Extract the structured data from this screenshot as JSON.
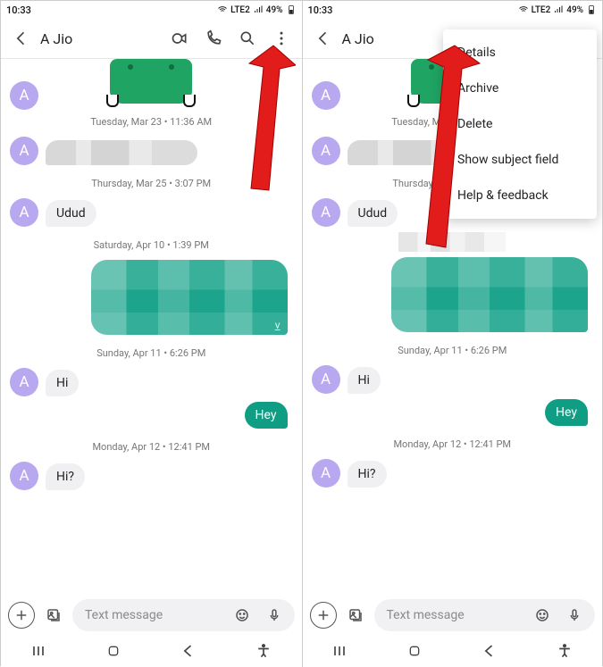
{
  "status": {
    "time": "10:33",
    "signal": "LTE2",
    "battery": "49%"
  },
  "chat": {
    "contactInitial": "A",
    "title": "A Jio",
    "days": {
      "d1": "Tuesday, Mar 23 • 11:36 AM",
      "d2": "Thursday, Mar 25 • 3:07 PM",
      "d3": "Saturday, Apr 10 • 1:39 PM",
      "d4": "Sunday, Apr 11 • 6:26 PM",
      "d5": "Monday, Apr 12 • 12:41 PM"
    },
    "msgs": {
      "m1": "Udud",
      "m2": "Hi",
      "m3": "Hey",
      "m4": "Hi?"
    }
  },
  "composer": {
    "placeholder": "Text message"
  },
  "menu": {
    "details": "Details",
    "archive": "Archive",
    "delete": "Delete",
    "subject": "Show subject field",
    "help": "Help & feedback"
  },
  "icons": {
    "back": "back-icon",
    "duo": "video-call-duo-icon",
    "call": "phone-icon",
    "search": "search-icon",
    "overflow": "overflow-menu-icon",
    "plus": "plus-icon",
    "gallery": "gallery-icon",
    "emoji": "emoji-icon",
    "mic": "mic-icon",
    "recents": "recents-nav-icon",
    "home": "home-nav-icon",
    "backnav": "back-nav-icon",
    "access": "accessibility-nav-icon"
  }
}
